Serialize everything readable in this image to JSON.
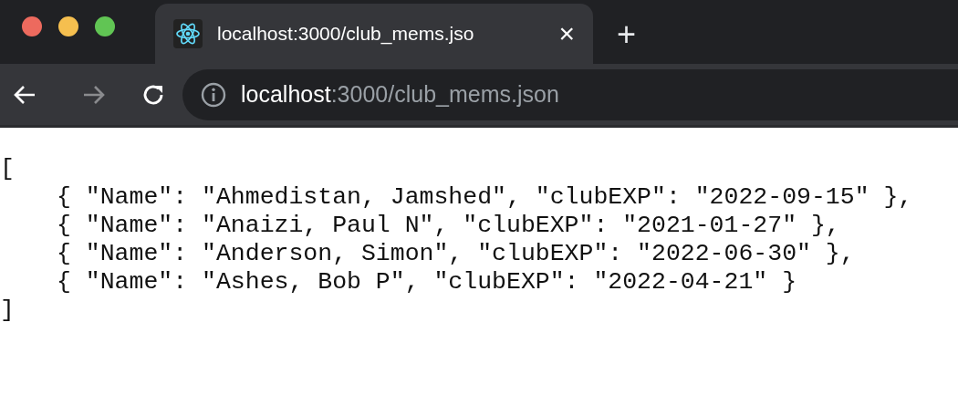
{
  "tab": {
    "title": "localhost:3000/club_mems.jso",
    "close": "×"
  },
  "new_tab": "+",
  "address_bar": {
    "host": "localhost",
    "path": ":3000/club_mems.json"
  },
  "document": {
    "open": "[",
    "lines": [
      "{ \"Name\": \"Ahmedistan, Jamshed\", \"clubEXP\": \"2022-09-15\" },",
      "{ \"Name\": \"Anaizi, Paul N\", \"clubEXP\": \"2021-01-27\" },",
      "{ \"Name\": \"Anderson, Simon\", \"clubEXP\": \"2022-06-30\" },",
      "{ \"Name\": \"Ashes, Bob P\", \"clubEXP\": \"2022-04-21\" }"
    ],
    "close": "]"
  }
}
